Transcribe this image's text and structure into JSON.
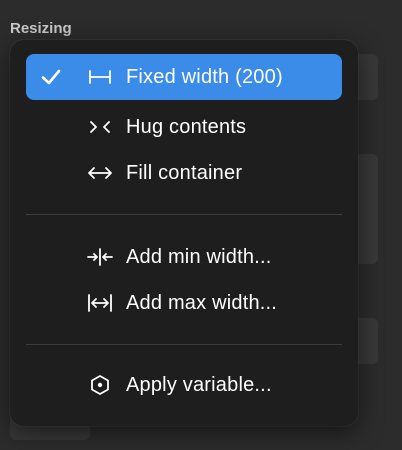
{
  "panel": {
    "section_label": "Resizing"
  },
  "menu": {
    "items": [
      {
        "label": "Fixed width (200)",
        "icon": "fixed-width-icon",
        "selected": true
      },
      {
        "label": "Hug contents",
        "icon": "hug-contents-icon",
        "selected": false
      },
      {
        "label": "Fill container",
        "icon": "fill-container-icon",
        "selected": false
      },
      {
        "label": "Add min width...",
        "icon": "min-width-icon",
        "selected": false
      },
      {
        "label": "Add max width...",
        "icon": "max-width-icon",
        "selected": false
      },
      {
        "label": "Apply variable...",
        "icon": "variable-hexagon-icon",
        "selected": false
      }
    ]
  },
  "colors": {
    "accent": "#3b8be8",
    "menu_background": "#1e1e1e",
    "panel_background": "#2c2c2c",
    "text": "#ffffff"
  }
}
